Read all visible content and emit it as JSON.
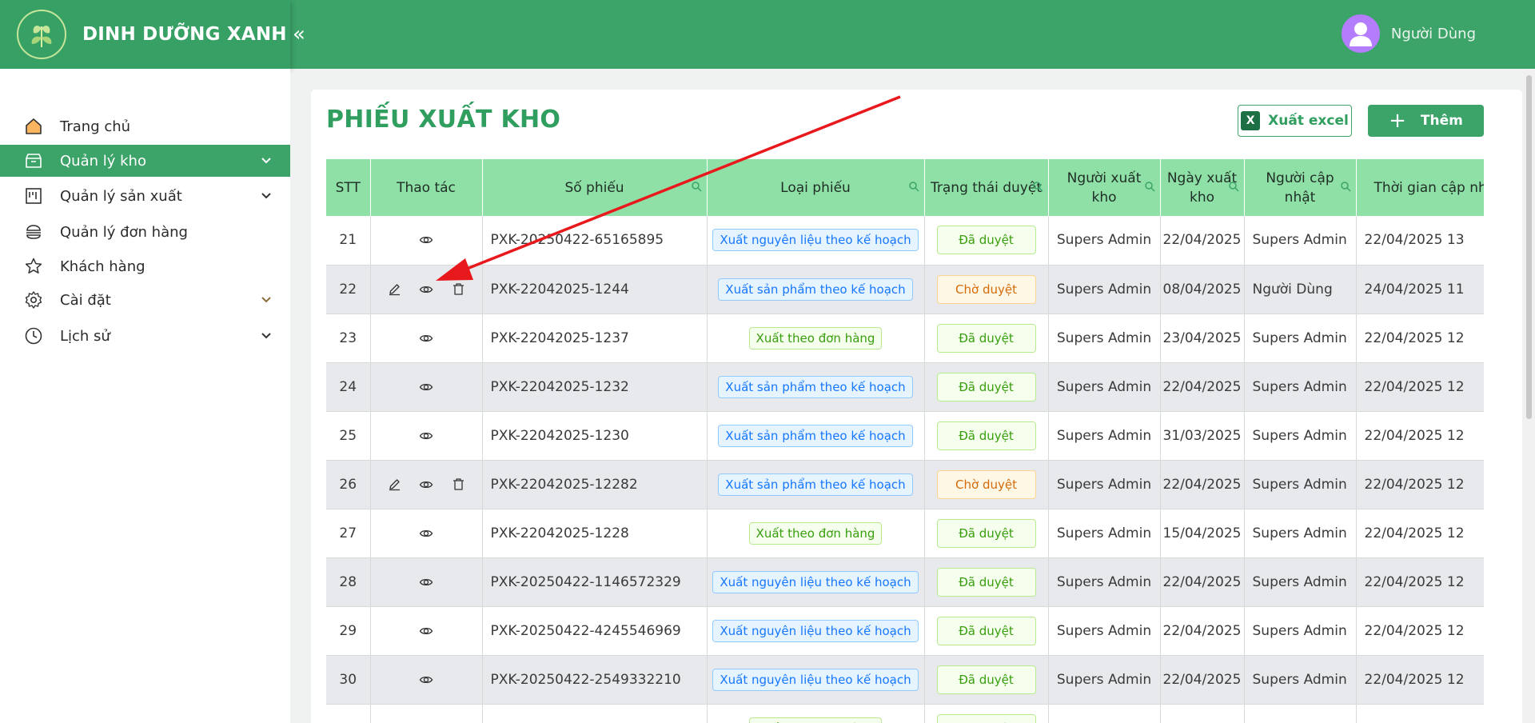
{
  "brand": {
    "title": "DINH DƯỠNG XANH"
  },
  "header": {
    "user_name": "Người Dùng",
    "collapse_symbol": "«"
  },
  "sidebar": {
    "items": [
      {
        "label": "Trang chủ",
        "icon": "home-icon",
        "has_chevron": false,
        "active": false
      },
      {
        "label": "Quản lý kho",
        "icon": "warehouse-icon",
        "has_chevron": true,
        "active": true
      },
      {
        "label": "Quản lý sản xuất",
        "icon": "production-icon",
        "has_chevron": true,
        "active": false
      },
      {
        "label": "Quản lý đơn hàng",
        "icon": "order-icon",
        "has_chevron": false,
        "active": false
      },
      {
        "label": "Khách hàng",
        "icon": "star-icon",
        "has_chevron": false,
        "active": false
      },
      {
        "label": "Cài đặt",
        "icon": "gear-icon",
        "has_chevron": true,
        "active": false
      },
      {
        "label": "Lịch sử",
        "icon": "history-icon",
        "has_chevron": true,
        "active": false
      }
    ]
  },
  "page": {
    "title": "PHIẾU XUẤT KHO",
    "excel_label": "Xuất excel",
    "add_label": "Thêm"
  },
  "table": {
    "columns": [
      "STT",
      "Thao tác",
      "Số phiếu",
      "Loại phiếu",
      "Trạng thái duyệt",
      "Người xuất kho",
      "Ngày xuất kho",
      "Người cập nhật",
      "Thời gian cập nhật"
    ],
    "rows": [
      {
        "stt": "21",
        "actions": [
          "view"
        ],
        "code": "PXK-20250422-65165895",
        "type": "Xuất nguyên liệu theo kế hoạch",
        "type_color": "blue",
        "status": "Đã duyệt",
        "status_kind": "ok",
        "exporter": "Supers Admin",
        "date": "22/04/2025",
        "updater": "Supers Admin",
        "updated": "22/04/2025 13"
      },
      {
        "stt": "22",
        "actions": [
          "edit",
          "view",
          "delete"
        ],
        "code": "PXK-22042025-1244",
        "type": "Xuất sản phẩm theo kế hoạch",
        "type_color": "blue",
        "status": "Chờ duyệt",
        "status_kind": "wait",
        "exporter": "Supers Admin",
        "date": "08/04/2025",
        "updater": "Người Dùng",
        "updated": "24/04/2025 11"
      },
      {
        "stt": "23",
        "actions": [
          "view"
        ],
        "code": "PXK-22042025-1237",
        "type": "Xuất theo đơn hàng",
        "type_color": "green",
        "status": "Đã duyệt",
        "status_kind": "ok",
        "exporter": "Supers Admin",
        "date": "23/04/2025",
        "updater": "Supers Admin",
        "updated": "22/04/2025 12"
      },
      {
        "stt": "24",
        "actions": [
          "view"
        ],
        "code": "PXK-22042025-1232",
        "type": "Xuất sản phẩm theo kế hoạch",
        "type_color": "blue",
        "status": "Đã duyệt",
        "status_kind": "ok",
        "exporter": "Supers Admin",
        "date": "22/04/2025",
        "updater": "Supers Admin",
        "updated": "22/04/2025 12"
      },
      {
        "stt": "25",
        "actions": [
          "view"
        ],
        "code": "PXK-22042025-1230",
        "type": "Xuất sản phẩm theo kế hoạch",
        "type_color": "blue",
        "status": "Đã duyệt",
        "status_kind": "ok",
        "exporter": "Supers Admin",
        "date": "31/03/2025",
        "updater": "Supers Admin",
        "updated": "22/04/2025 12"
      },
      {
        "stt": "26",
        "actions": [
          "edit",
          "view",
          "delete"
        ],
        "code": "PXK-22042025-12282",
        "type": "Xuất sản phẩm theo kế hoạch",
        "type_color": "blue",
        "status": "Chờ duyệt",
        "status_kind": "wait",
        "exporter": "Supers Admin",
        "date": "22/04/2025",
        "updater": "Supers Admin",
        "updated": "22/04/2025 12"
      },
      {
        "stt": "27",
        "actions": [
          "view"
        ],
        "code": "PXK-22042025-1228",
        "type": "Xuất theo đơn hàng",
        "type_color": "green",
        "status": "Đã duyệt",
        "status_kind": "ok",
        "exporter": "Supers Admin",
        "date": "15/04/2025",
        "updater": "Supers Admin",
        "updated": "22/04/2025 12"
      },
      {
        "stt": "28",
        "actions": [
          "view"
        ],
        "code": "PXK-20250422-1146572329",
        "type": "Xuất nguyên liệu theo kế hoạch",
        "type_color": "blue",
        "status": "Đã duyệt",
        "status_kind": "ok",
        "exporter": "Supers Admin",
        "date": "22/04/2025",
        "updater": "Supers Admin",
        "updated": "22/04/2025 12"
      },
      {
        "stt": "29",
        "actions": [
          "view"
        ],
        "code": "PXK-20250422-4245546969",
        "type": "Xuất nguyên liệu theo kế hoạch",
        "type_color": "blue",
        "status": "Đã duyệt",
        "status_kind": "ok",
        "exporter": "Supers Admin",
        "date": "22/04/2025",
        "updater": "Supers Admin",
        "updated": "22/04/2025 12"
      },
      {
        "stt": "30",
        "actions": [
          "view"
        ],
        "code": "PXK-20250422-2549332210",
        "type": "Xuất nguyên liệu theo kế hoạch",
        "type_color": "blue",
        "status": "Đã duyệt",
        "status_kind": "ok",
        "exporter": "Supers Admin",
        "date": "22/04/2025",
        "updater": "Supers Admin",
        "updated": "22/04/2025 12"
      },
      {
        "stt": "",
        "actions": [],
        "code": "",
        "type": "Xuất theo đơn hàng",
        "type_color": "green",
        "status": "Đã duyệt",
        "status_kind": "ok",
        "exporter": "",
        "date": "",
        "updater": "",
        "updated": ""
      }
    ]
  },
  "colors": {
    "primary": "#3ca369",
    "header_bg": "#3ca369",
    "table_head": "#8fe0a6",
    "annotation_arrow": "#e8191c"
  }
}
